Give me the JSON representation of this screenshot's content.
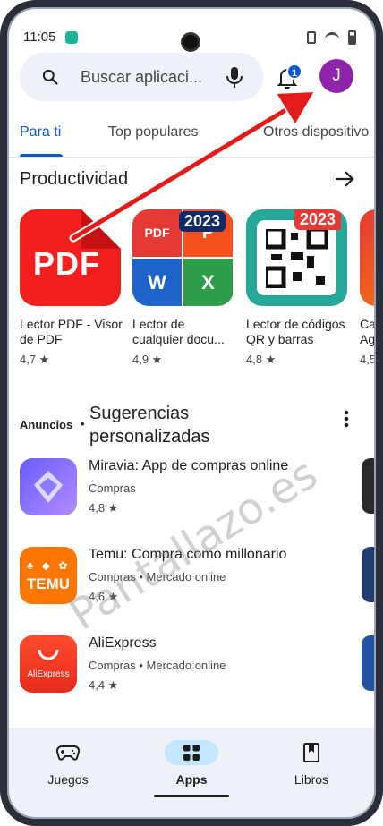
{
  "status_bar": {
    "time": "11:05"
  },
  "search": {
    "placeholder": "Buscar aplicaci..."
  },
  "header": {
    "notification_count": "1",
    "avatar_letter": "J",
    "avatar_color": "#8e24aa"
  },
  "tabs": [
    {
      "label": "Para ti",
      "active": true
    },
    {
      "label": "Top populares",
      "active": false
    },
    {
      "label": "Otros dispositivo",
      "active": false
    }
  ],
  "productividad": {
    "title": "Productividad",
    "apps": [
      {
        "icon": "pdf-app-icon",
        "tile_text": "PDF",
        "name_line1": "Lector PDF - Visor",
        "name_line2": "de PDF",
        "rating": "4,7 ★"
      },
      {
        "icon": "office-app-icon",
        "tile_year": "2023",
        "tile_labels": [
          "PDF",
          "P",
          "W",
          "X"
        ],
        "name_line1": "Lector de",
        "name_line2": "cualquier docu...",
        "rating": "4,9 ★"
      },
      {
        "icon": "qr-app-icon",
        "tile_year": "2023",
        "name_line1": "Lector de códigos",
        "name_line2": "QR y barras",
        "rating": "4,8 ★"
      },
      {
        "icon": "partial-app-icon",
        "name_line1": "Ca",
        "name_line2": "Ag",
        "rating": "4,5"
      }
    ]
  },
  "ads": {
    "label": "Anuncios",
    "separator": "•",
    "title_line1": "Sugerencias",
    "title_line2": "personalizadas",
    "items": [
      {
        "title": "Miravia: App de compras online",
        "category": "Compras",
        "rating": "4,8 ★"
      },
      {
        "title": "Temu: Compra como millonario",
        "category": "Compras • Mercado online",
        "rating": "4,6 ★",
        "icon_text": "TEMU"
      },
      {
        "title": "AliExpress",
        "category": "Compras • Mercado online",
        "rating": "4,4 ★",
        "icon_text": "AliExpress"
      }
    ]
  },
  "bottom_nav": [
    {
      "label": "Juegos",
      "icon": "gamepad-icon",
      "active": false
    },
    {
      "label": "Apps",
      "icon": "apps-grid-icon",
      "active": true
    },
    {
      "label": "Libros",
      "icon": "bookmark-book-icon",
      "active": false
    }
  ],
  "watermark": "Pantallazo.es",
  "colors": {
    "accent": "#0b57d0",
    "annotation_arrow": "#e31b1b",
    "nav_active": "#c2e7ff"
  }
}
